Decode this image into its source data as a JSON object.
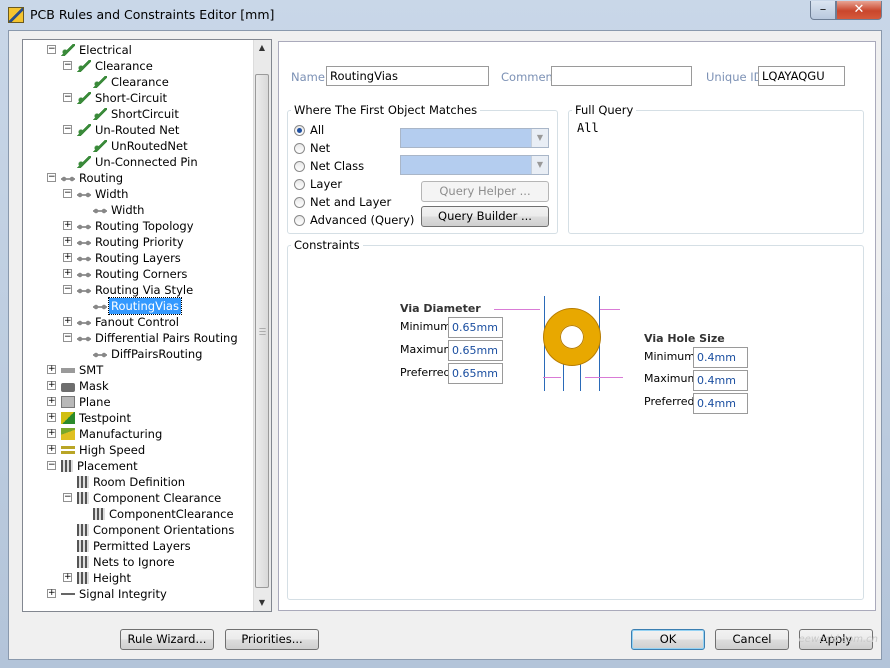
{
  "window": {
    "title": "PCB Rules and Constraints Editor [mm]",
    "minimize": "–",
    "close": "✕"
  },
  "tree": {
    "collapse": "−",
    "expand": "+",
    "nodes": [
      {
        "label": "Electrical",
        "icon": "electrical-icon"
      },
      {
        "label": "Clearance",
        "icon": "electrical-icon"
      },
      {
        "label": "Clearance",
        "icon": "electrical-icon"
      },
      {
        "label": "Short-Circuit",
        "icon": "electrical-icon"
      },
      {
        "label": "ShortCircuit",
        "icon": "electrical-icon"
      },
      {
        "label": "Un-Routed Net",
        "icon": "electrical-icon"
      },
      {
        "label": "UnRoutedNet",
        "icon": "electrical-icon"
      },
      {
        "label": "Un-Connected Pin",
        "icon": "electrical-icon"
      },
      {
        "label": "Routing",
        "icon": "routing-icon"
      },
      {
        "label": "Width",
        "icon": "routing-icon"
      },
      {
        "label": "Width",
        "icon": "routing-icon"
      },
      {
        "label": "Routing Topology",
        "icon": "routing-icon"
      },
      {
        "label": "Routing Priority",
        "icon": "routing-icon"
      },
      {
        "label": "Routing Layers",
        "icon": "routing-icon"
      },
      {
        "label": "Routing Corners",
        "icon": "routing-icon"
      },
      {
        "label": "Routing Via Style",
        "icon": "routing-icon"
      },
      {
        "label": "RoutingVias",
        "icon": "routing-icon",
        "selected": true
      },
      {
        "label": "Fanout Control",
        "icon": "routing-icon"
      },
      {
        "label": "Differential Pairs Routing",
        "icon": "routing-icon"
      },
      {
        "label": "DiffPairsRouting",
        "icon": "routing-icon"
      },
      {
        "label": "SMT",
        "icon": "smt-icon"
      },
      {
        "label": "Mask",
        "icon": "mask-icon"
      },
      {
        "label": "Plane",
        "icon": "plane-icon"
      },
      {
        "label": "Testpoint",
        "icon": "testpoint-icon"
      },
      {
        "label": "Manufacturing",
        "icon": "manufacturing-icon"
      },
      {
        "label": "High Speed",
        "icon": "high-speed-icon"
      },
      {
        "label": "Placement",
        "icon": "placement-icon"
      },
      {
        "label": "Room Definition",
        "icon": "placement-icon"
      },
      {
        "label": "Component Clearance",
        "icon": "placement-icon"
      },
      {
        "label": "ComponentClearance",
        "icon": "placement-icon"
      },
      {
        "label": "Component Orientations",
        "icon": "placement-icon"
      },
      {
        "label": "Permitted Layers",
        "icon": "placement-icon"
      },
      {
        "label": "Nets to Ignore",
        "icon": "placement-icon"
      },
      {
        "label": "Height",
        "icon": "placement-icon"
      },
      {
        "label": "Signal Integrity",
        "icon": "signal-integrity-icon"
      }
    ]
  },
  "rule": {
    "name_label": "Name",
    "name_value": "RoutingVias",
    "comment_label": "Comment",
    "comment_value": "",
    "uid_label": "Unique ID",
    "uid_value": "LQAYAQGU"
  },
  "match": {
    "title": "Where The First Object Matches",
    "options": [
      "All",
      "Net",
      "Net Class",
      "Layer",
      "Net and Layer",
      "Advanced (Query)"
    ],
    "selected": "All",
    "query_helper": "Query Helper ...",
    "query_builder": "Query Builder ..."
  },
  "full_query": {
    "title": "Full Query",
    "text": "All"
  },
  "constraints": {
    "title": "Constraints",
    "via_diameter": {
      "title": "Via Diameter",
      "minimum_label": "Minimum",
      "minimum": "0.65mm",
      "maximum_label": "Maximum",
      "maximum": "0.65mm",
      "preferred_label": "Preferred",
      "preferred": "0.65mm"
    },
    "via_hole": {
      "title": "Via Hole Size",
      "minimum_label": "Minimum",
      "minimum": "0.4mm",
      "maximum_label": "Maximum",
      "maximum": "0.4mm",
      "preferred_label": "Preferred",
      "preferred": "0.4mm"
    },
    "via_color": "#e8a800"
  },
  "buttons": {
    "rule_wizard": "Rule Wizard...",
    "priorities": "Priorities...",
    "ok": "OK",
    "cancel": "Cancel",
    "apply": "Apply"
  },
  "watermark": "eeworld.com.cn"
}
